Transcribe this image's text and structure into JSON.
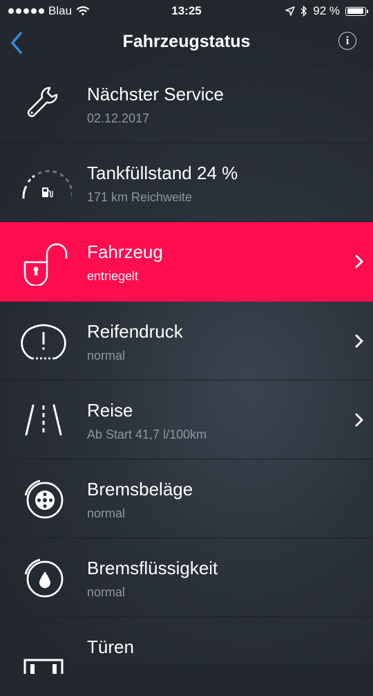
{
  "status_bar": {
    "carrier": "Blau",
    "time": "13:25",
    "battery_percent": "92 %",
    "battery_level": 0.92
  },
  "nav": {
    "title": "Fahrzeugstatus",
    "info_label": "i",
    "back_icon": "chevron-left-icon"
  },
  "colors": {
    "accent": "#2f8fe0",
    "highlight": "#ff0d4f",
    "subtitle": "#8e96a0"
  },
  "items": [
    {
      "icon": "wrench-icon",
      "title": "Nächster Service",
      "subtitle": "02.12.2017",
      "chevron": false
    },
    {
      "icon": "fuel-gauge-icon",
      "title": "Tankfüllstand 24 %",
      "subtitle": "171 km Reichweite",
      "chevron": false,
      "fuel_level": 0.24
    },
    {
      "icon": "padlock-open-icon",
      "title": "Fahrzeug",
      "subtitle": "entriegelt",
      "chevron": true,
      "active": true
    },
    {
      "icon": "tire-pressure-icon",
      "title": "Reifendruck",
      "subtitle": "normal",
      "chevron": true
    },
    {
      "icon": "road-icon",
      "title": "Reise",
      "subtitle": "Ab Start 41,7 l/100km",
      "chevron": true
    },
    {
      "icon": "brake-disc-icon",
      "title": "Bremsbeläge",
      "subtitle": "normal",
      "chevron": false
    },
    {
      "icon": "brake-fluid-icon",
      "title": "Bremsflüssigkeit",
      "subtitle": "normal",
      "chevron": false
    },
    {
      "icon": "car-doors-icon",
      "title": "Türen",
      "subtitle": "",
      "chevron": false
    }
  ]
}
